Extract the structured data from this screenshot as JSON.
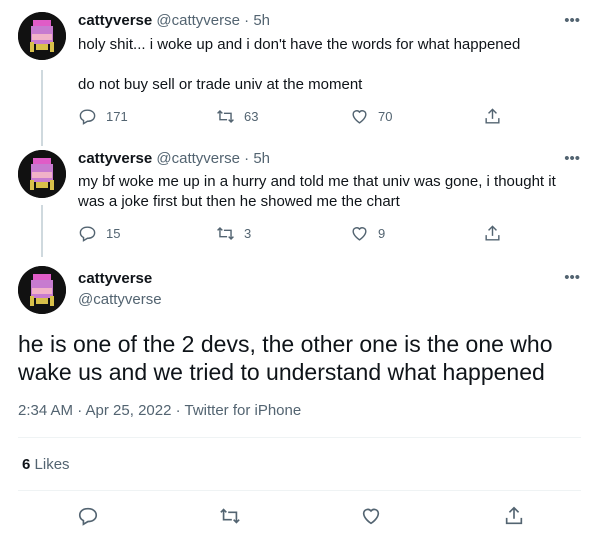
{
  "colors": {
    "text": "#0f1419",
    "secondary": "#536471",
    "divider": "#eff3f4",
    "thread_line": "#cfd9de"
  },
  "tweets": [
    {
      "name": "cattyverse",
      "handle": "@cattyverse",
      "dot": "·",
      "time": "5h",
      "line1": "holy shit... i woke up and i don't have the words for what happened",
      "line2": "do not buy sell or trade univ at the moment",
      "replies": "171",
      "retweets": "63",
      "likes": "70"
    },
    {
      "name": "cattyverse",
      "handle": "@cattyverse",
      "dot": "·",
      "time": "5h",
      "line1": "my bf woke me up in a hurry and told me that univ was gone, i thought it",
      "line2": "was a joke first but then he showed me the chart",
      "replies": "15",
      "retweets": "3",
      "likes": "9"
    }
  ],
  "main_tweet": {
    "name": "cattyverse",
    "handle": "@cattyverse",
    "text": "he is one of the 2 devs, the other one is the one who wake us and we tried to understand what happened",
    "meta": "2:34 AM · Apr 25, 2022 · Twitter for iPhone",
    "like_count": "6",
    "like_label": "Likes"
  },
  "more_label": "•••",
  "icons": [
    "reply-icon",
    "retweet-icon",
    "like-icon",
    "share-icon",
    "more-icon"
  ]
}
